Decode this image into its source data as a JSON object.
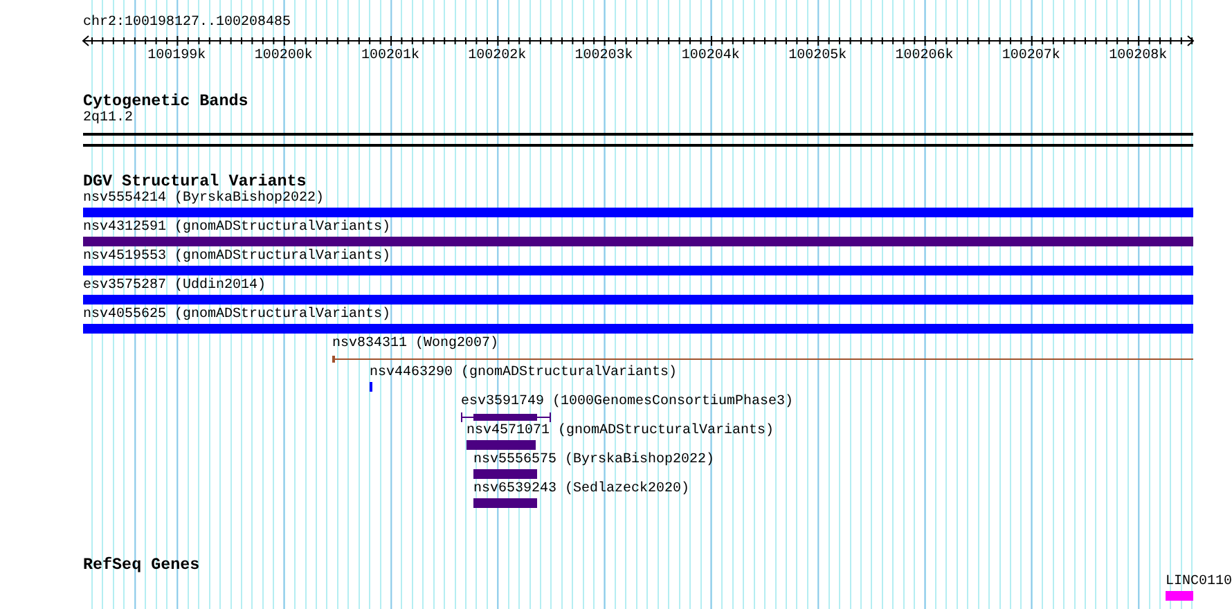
{
  "location": "chr2:100198127..100208485",
  "ruler": {
    "ticks": [
      "100199k",
      "100200k",
      "100201k",
      "100202k",
      "100203k",
      "100204k",
      "100205k",
      "100206k",
      "100207k",
      "100208k"
    ]
  },
  "tracks": [
    {
      "kind": "bands",
      "title": "Cytogenetic Bands",
      "features": [
        {
          "label": "2q11.2",
          "kind": "band",
          "color": "#000000"
        }
      ]
    },
    {
      "kind": "variants",
      "title": "DGV Structural Variants",
      "features": [
        {
          "label": "nsv5554214 (ByrskaBishop2022)",
          "kind": "bar",
          "color": "#0000ff"
        },
        {
          "label": "nsv4312591 (gnomADStructuralVariants)",
          "kind": "bar",
          "color": "#4b0082"
        },
        {
          "label": "nsv4519553 (gnomADStructuralVariants)",
          "kind": "bar",
          "color": "#0000ff"
        },
        {
          "label": "esv3575287 (Uddin2014)",
          "kind": "bar",
          "color": "#0000ff"
        },
        {
          "label": "nsv4055625 (gnomADStructuralVariants)",
          "kind": "bar",
          "color": "#0000ff"
        },
        {
          "label": "nsv834311 (Wong2007)",
          "kind": "line",
          "color": "#a0522d"
        },
        {
          "label": "nsv4463290 (gnomADStructuralVariants)",
          "kind": "bar",
          "color": "#0000ff"
        },
        {
          "label": "esv3591749 (1000GenomesConsortiumPhase3)",
          "kind": "whisker",
          "color": "#4b0082"
        },
        {
          "label": "nsv4571071 (gnomADStructuralVariants)",
          "kind": "bar",
          "color": "#4b0082"
        },
        {
          "label": "nsv5556575 (ByrskaBishop2022)",
          "kind": "bar",
          "color": "#4b0082"
        },
        {
          "label": "nsv6539243 (Sedlazeck2020)",
          "kind": "bar",
          "color": "#4b0082"
        }
      ]
    },
    {
      "kind": "genes",
      "title": "RefSeq Genes",
      "features": [
        {
          "label": "LINC0110",
          "kind": "bar",
          "color": "#ff00ff"
        }
      ]
    }
  ]
}
